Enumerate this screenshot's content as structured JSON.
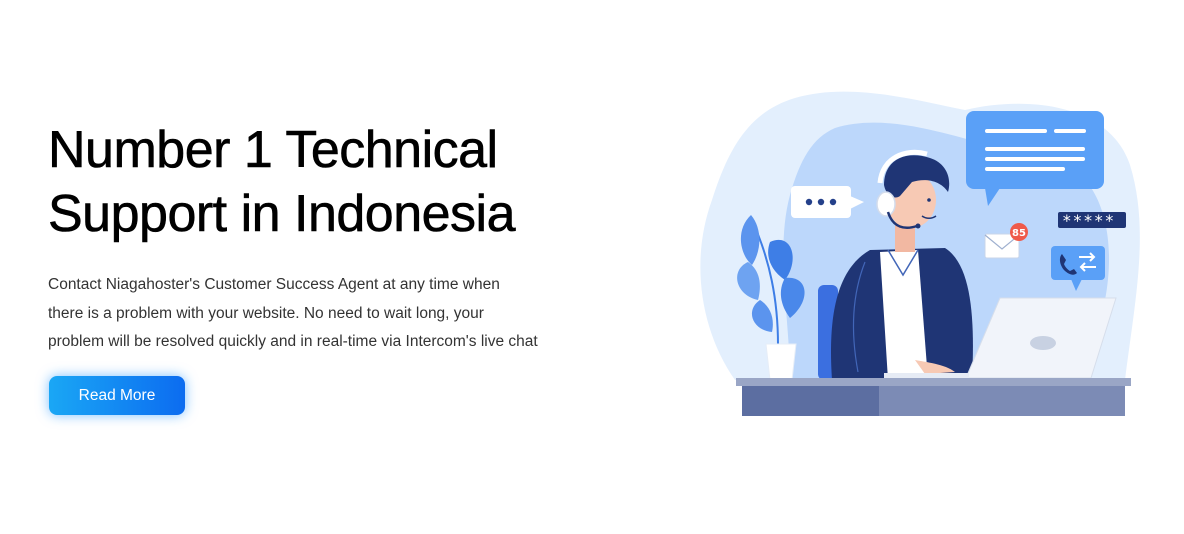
{
  "hero": {
    "title_lines": [
      "Number 1 Technical",
      "Support in Indonesia"
    ],
    "description_lines": [
      "Contact Niagahoster's Customer Success Agent at any time when",
      "there is a problem with your website. No need to wait long, your",
      "problem will be resolved quickly and in real-time via Intercom's live chat"
    ],
    "cta_label": "Read More"
  },
  "illustration": {
    "notification_count": "85",
    "password_mask": "*****"
  },
  "colors": {
    "accent_start": "#1aa7f5",
    "accent_end": "#0c6cf0",
    "blob_light": "#e3effd",
    "blob_mid": "#bcd7fb",
    "bubble_blue": "#5aa0f7",
    "navy": "#1f3575",
    "notification_red": "#ef5a4a"
  }
}
